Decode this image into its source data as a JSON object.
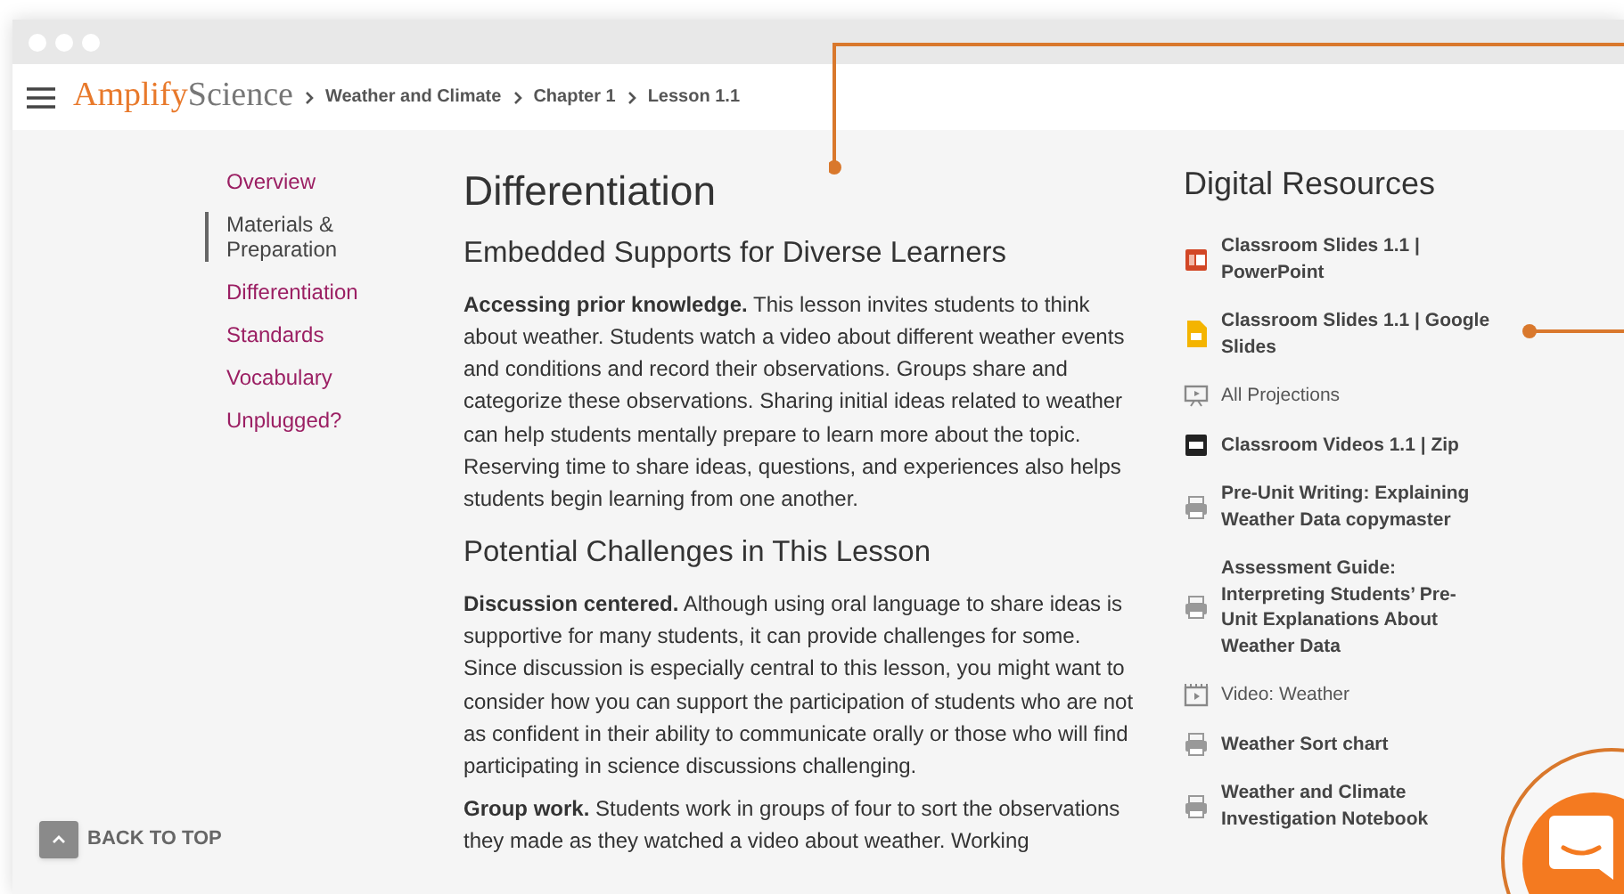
{
  "header": {
    "logo_primary": "Amplify",
    "logo_secondary": "Science",
    "breadcrumbs": [
      "Weather and Climate",
      "Chapter 1",
      "Lesson 1.1"
    ]
  },
  "nav": [
    {
      "label": "Overview",
      "selected": false
    },
    {
      "label": "Materials & Preparation",
      "selected": true
    },
    {
      "label": "Differentiation",
      "selected": false
    },
    {
      "label": "Standards",
      "selected": false
    },
    {
      "label": "Vocabulary",
      "selected": false
    },
    {
      "label": "Unplugged?",
      "selected": false
    }
  ],
  "back_to_top": "BACK TO TOP",
  "main": {
    "title": "Differentiation",
    "sections": [
      {
        "heading": "Embedded Supports for Diverse Learners",
        "paragraphs": [
          "**Accessing prior knowledge.** This lesson invites students to think about weather. Students watch a video about different weather events and conditions and record their observations. Groups share and categorize these observations. Sharing initial ideas related to weather can help students mentally prepare to learn more about the topic. Reserving time to share ideas, questions, and experiences also helps students begin learning from one another."
        ]
      },
      {
        "heading": "Potential Challenges in This Lesson",
        "paragraphs": [
          "**Discussion centered.** Although using oral language to share ideas is supportive for many students, it can provide challenges for some. Since discussion is especially central to this lesson, you might want to consider how you can support the participation of students who are not as confident in their ability to communicate orally or those who will find participating in science discussions challenging.",
          "**Group work.** Students work in groups of four to sort the observations they made as they watched a video about weather. Working"
        ]
      }
    ]
  },
  "resources": {
    "title": "Digital Resources",
    "items": [
      {
        "kind": "powerpoint",
        "label": "Classroom Slides 1.1 | PowerPoint"
      },
      {
        "kind": "google-slides",
        "label": "Classroom Slides 1.1 | Google Slides"
      },
      {
        "kind": "projection",
        "label": "All Projections"
      },
      {
        "kind": "zip",
        "label": "Classroom Videos 1.1 | Zip"
      },
      {
        "kind": "pdf",
        "label": "Pre-Unit Writing: Explaining Weather Data copymaster"
      },
      {
        "kind": "pdf",
        "label": "Assessment Guide: Interpreting Students’ Pre-Unit Explanations About Weather Data"
      },
      {
        "kind": "video",
        "label": "Video: Weather"
      },
      {
        "kind": "pdf",
        "label": "Weather Sort chart"
      },
      {
        "kind": "pdf",
        "label": "Weather and Climate Investigation Notebook"
      }
    ]
  }
}
